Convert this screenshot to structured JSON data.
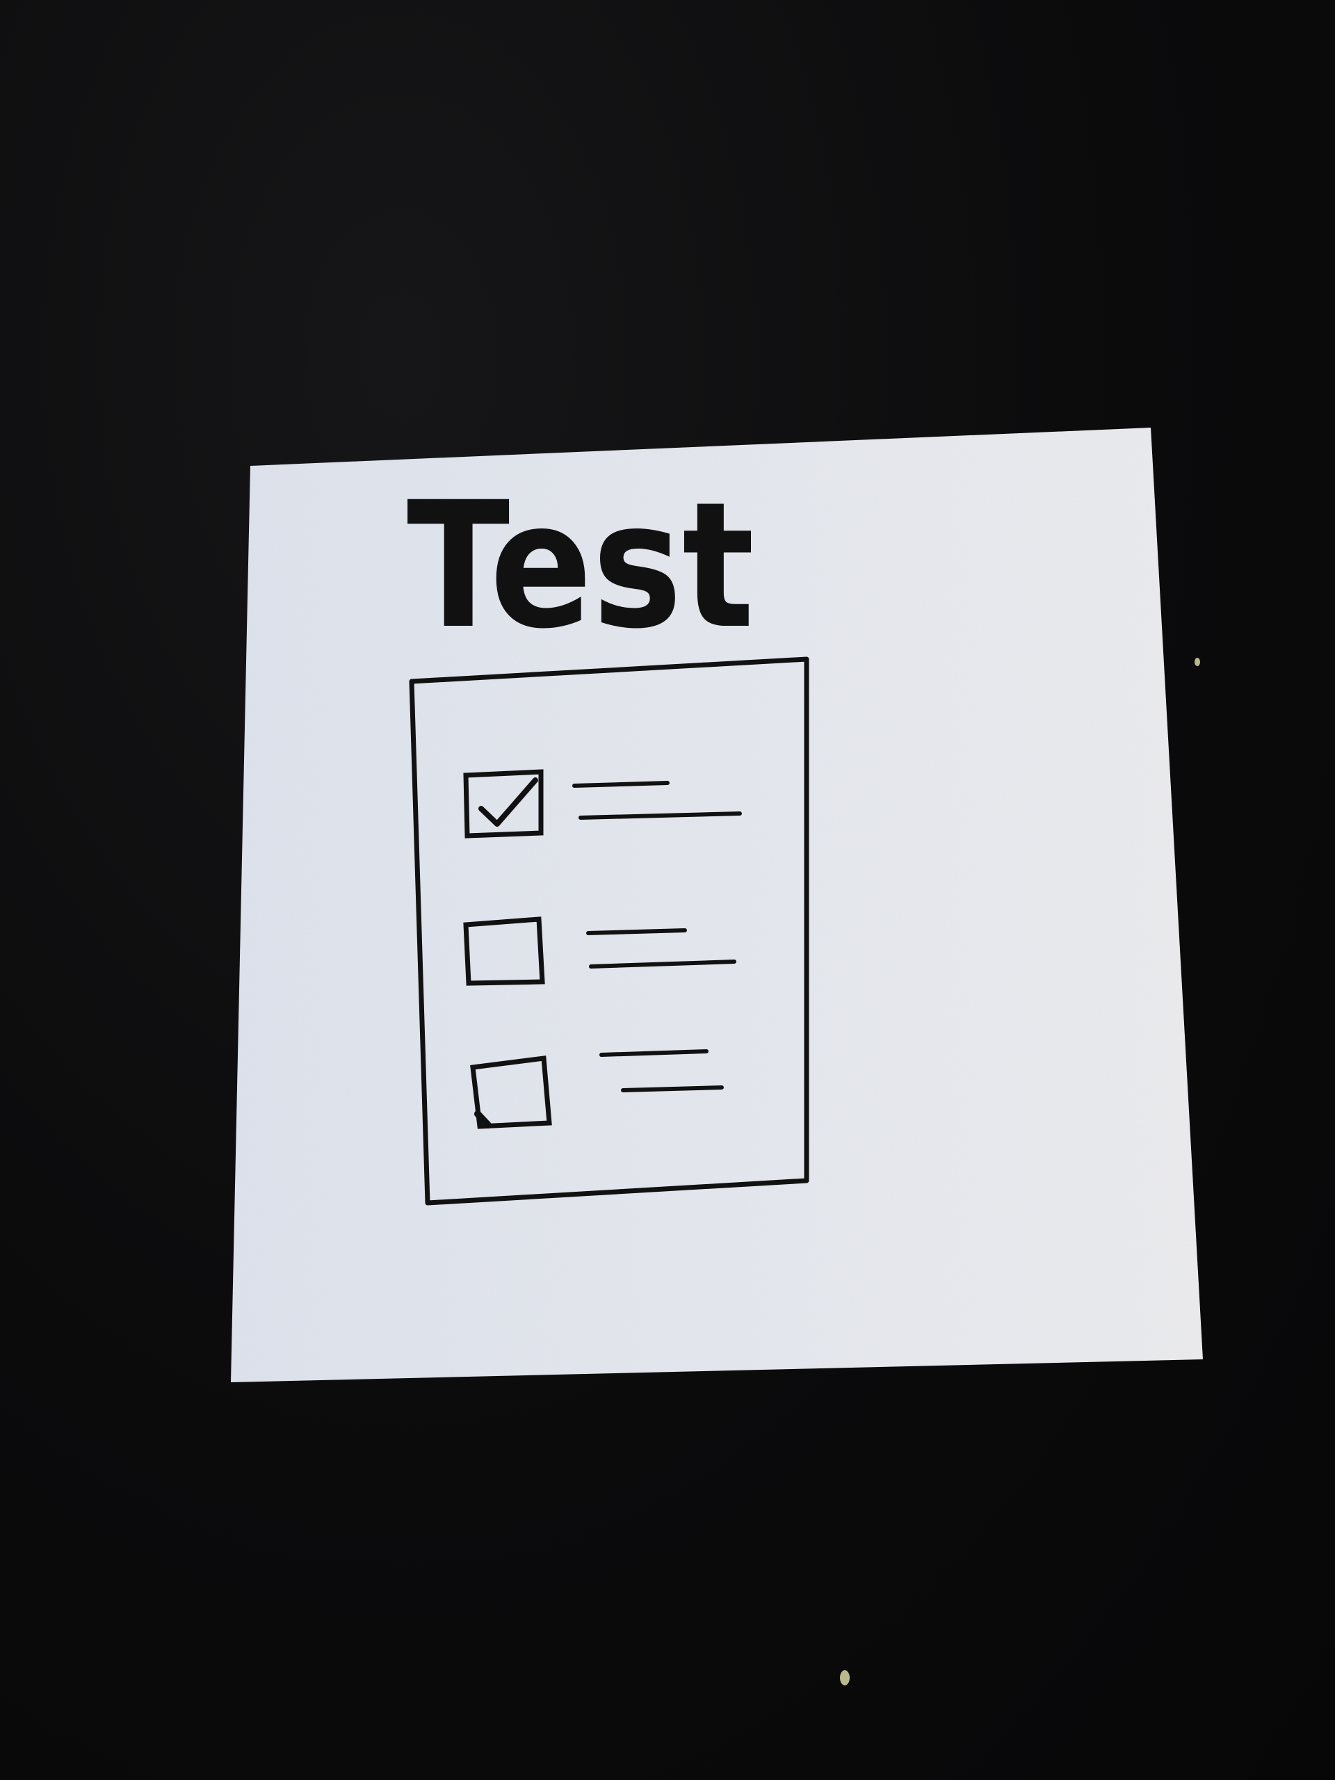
{
  "scene": {
    "background_color": "#0b0b0c",
    "paper_color": "#e4e7ee",
    "ink_color": "#111111"
  },
  "note": {
    "title": "Test",
    "checklist": {
      "items": [
        {
          "checked": true
        },
        {
          "checked": false
        },
        {
          "checked": false
        }
      ]
    }
  }
}
